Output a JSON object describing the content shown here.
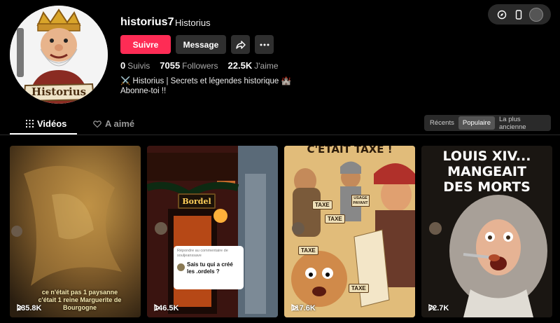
{
  "profile": {
    "username": "historius7",
    "nickname": "Historius",
    "avatar_text": "Historius",
    "follow_label": "Suivre",
    "message_label": "Message",
    "stats": [
      {
        "value": "0",
        "label": "Suivis"
      },
      {
        "value": "7055",
        "label": "Followers"
      },
      {
        "value": "22.5K",
        "label": "J'aime"
      }
    ],
    "bio_line1": "⚔️ Historius | Secrets et légendes historique 🏰",
    "bio_line2": "Abonne-toi !!"
  },
  "tabs": {
    "videos": "Vidéos",
    "liked": "A aimé"
  },
  "sort": {
    "options": [
      "Récents",
      "Populaire",
      "La plus ancienne"
    ],
    "active": "Populaire"
  },
  "videos": [
    {
      "views": "235.8K",
      "caption_line1": "ce n'était pas 1 paysanne",
      "caption_line2": "c'était 1 reine Marguerite de",
      "caption_line3": "Bourgogne"
    },
    {
      "views": "146.5K",
      "sign": "Bordel",
      "comment_header": "Répondre au commentaire de",
      "comment_user": "souljeanssave",
      "comment_text": "Sais tu qui a créé les .ordels ?"
    },
    {
      "views": "117.6K",
      "banner": "C'ETAIT TAXE !",
      "tags": [
        "TAXE",
        "TAXE",
        "TAXE",
        "TAXE",
        "USAGE PAYANT"
      ]
    },
    {
      "views": "72.7K",
      "title_line1": "LOUIS XIV...",
      "title_line2": "MANGEAIT",
      "title_line3": "DES MORTS"
    }
  ],
  "colors": {
    "accent": "#fe2c55",
    "background": "#000000",
    "surface": "#2f2f2f"
  }
}
